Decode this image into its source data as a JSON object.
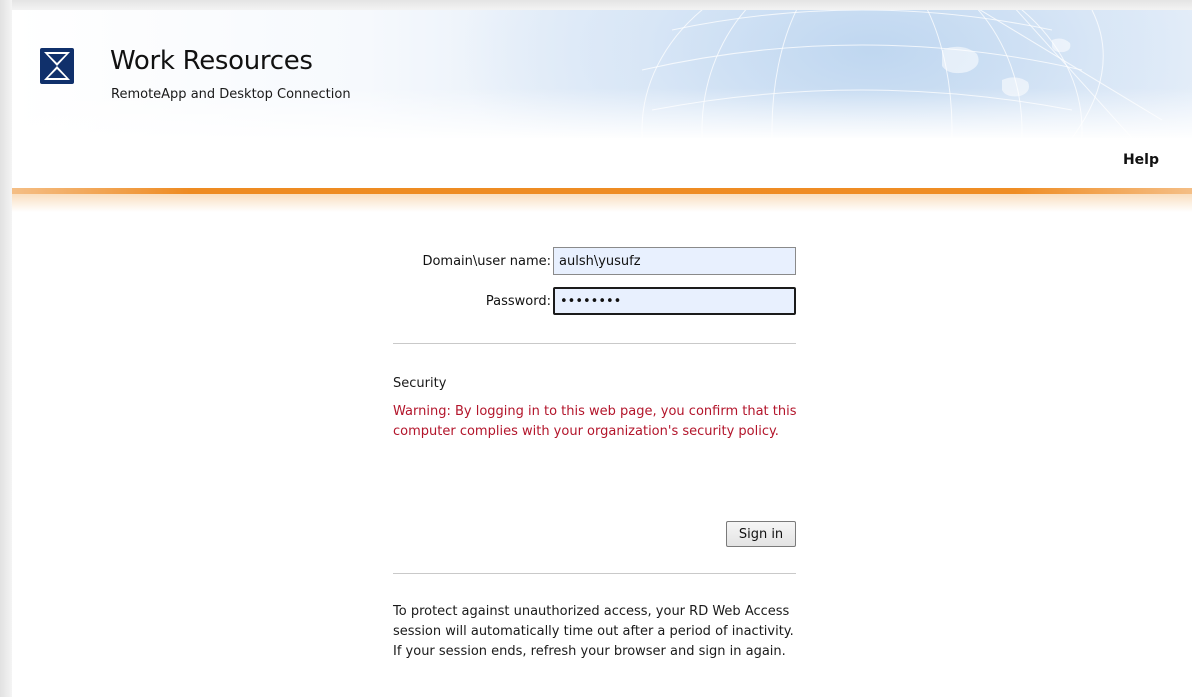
{
  "header": {
    "title": "Work Resources",
    "subtitle": "RemoteApp and Desktop Connection",
    "help_label": "Help",
    "logo_icon": "rdweb-logo-icon",
    "accent_color": "#ee8b22"
  },
  "login_form": {
    "username_label": "Domain\\user name:",
    "username_value": "aulsh\\yusufz",
    "password_label": "Password:",
    "password_value": "••••••••",
    "signin_label": "Sign in"
  },
  "security": {
    "title": "Security",
    "warning": "Warning: By logging in to this web page, you confirm that this computer complies with your organization's security policy.",
    "warning_color": "#b3152b"
  },
  "notice": {
    "text": "To protect against unauthorized access, your RD Web Access session will automatically time out after a period of inactivity. If your session ends, refresh your browser and sign in again."
  }
}
